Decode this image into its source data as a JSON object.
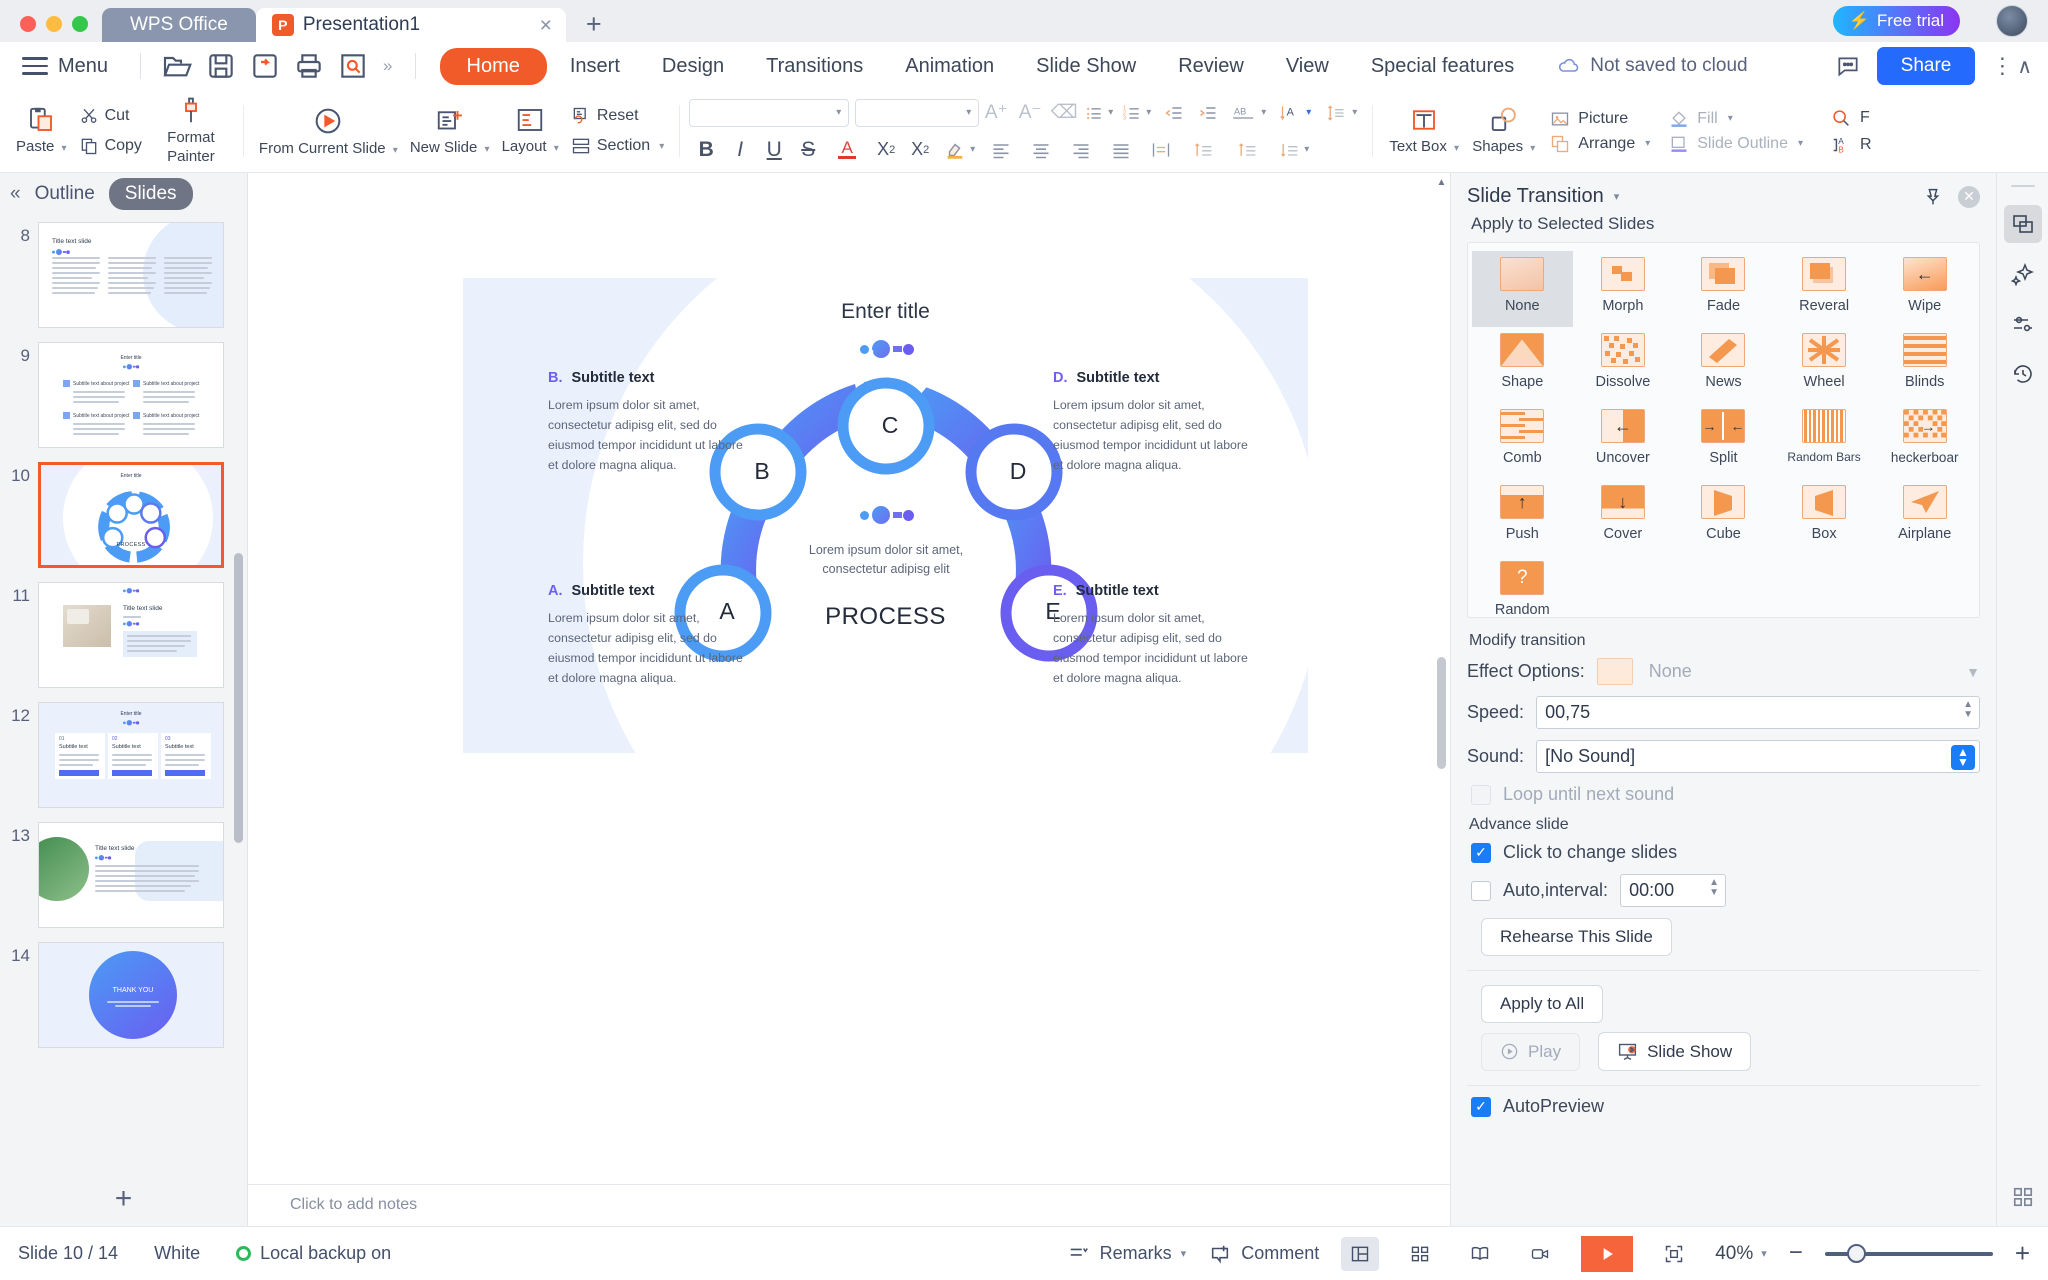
{
  "titlebar": {
    "wps_tab": "WPS Office",
    "doc_tab": "Presentation1",
    "doc_badge": "P",
    "close_glyph": "×",
    "newtab_glyph": "+",
    "free_trial": "Free trial",
    "bolt_glyph": "⚡"
  },
  "menubar": {
    "menu_label": "Menu",
    "quick_icons": [
      "open-folder-icon",
      "save-icon",
      "save-as-icon",
      "print-icon",
      "print-preview-icon"
    ],
    "overflow_glyph": "»",
    "tabs": [
      {
        "label": "Home",
        "active": true
      },
      {
        "label": "Insert",
        "active": false
      },
      {
        "label": "Design",
        "active": false
      },
      {
        "label": "Transitions",
        "active": false
      },
      {
        "label": "Animation",
        "active": false
      },
      {
        "label": "Slide Show",
        "active": false
      },
      {
        "label": "Review",
        "active": false
      },
      {
        "label": "View",
        "active": false
      },
      {
        "label": "Special features",
        "active": false
      }
    ],
    "cloud_status": "Not saved to cloud",
    "share_label": "Share",
    "kebab_glyph": "⋮",
    "collapse_glyph": "∧"
  },
  "ribbon": {
    "paste": "Paste",
    "cut": "Cut",
    "copy": "Copy",
    "format_painter": "Format Painter",
    "from_current_slide": "From Current Slide",
    "new_slide": "New Slide",
    "layout": "Layout",
    "reset": "Reset",
    "section": "Section",
    "font_name": "",
    "font_size": "",
    "font_name_placeholder": "",
    "font_size_placeholder": "",
    "text_box": "Text Box",
    "shapes": "Shapes",
    "picture": "Picture",
    "arrange": "Arrange",
    "fill": "Fill",
    "slide_outline": "Slide Outline",
    "find": "F",
    "replace": "R",
    "caret_glyph": "▾",
    "icons": {
      "bold": "B",
      "italic": "I",
      "underline": "U",
      "strike": "S",
      "font_color": "A",
      "superscript": "X²",
      "subscript": "X₂",
      "highlight": "A",
      "grow_font": "A⁺",
      "shrink_font": "A⁻",
      "clear_format": "⌫"
    }
  },
  "leftpanel": {
    "collapse_glyph": "«",
    "outline_tab": "Outline",
    "slides_tab": "Slides",
    "add_slide_glyph": "+",
    "slides": [
      {
        "number": "8",
        "title": "Title text slide",
        "kind": "three-col-text",
        "active": false
      },
      {
        "number": "9",
        "title": "Enter title",
        "kind": "four-quad",
        "active": false
      },
      {
        "number": "10",
        "title": "Enter title",
        "kind": "process-wheel",
        "active": true
      },
      {
        "number": "11",
        "title": "Title text slide",
        "kind": "photo-left",
        "active": false
      },
      {
        "number": "12",
        "title": "Enter title",
        "kind": "three-cards",
        "active": false
      },
      {
        "number": "13",
        "title": "Title text slide",
        "kind": "leaf-left",
        "active": false
      },
      {
        "number": "14",
        "title": "THANK YOU",
        "kind": "thankyou",
        "active": false
      }
    ]
  },
  "slide": {
    "title": "Enter title",
    "center_text": "Lorem ipsum dolor sit amet, consectetur adipisg elit",
    "process_label": "PROCESS",
    "rings": [
      "A",
      "B",
      "C",
      "D",
      "E"
    ],
    "body_text": "Lorem ipsum dolor sit amet, consectetur adipisg elit, sed do eiusmod tempor incididunt ut labore et dolore magna aliqua.",
    "blocks": [
      {
        "letter": "B.",
        "subtitle": "Subtitle text",
        "pos": "top-left"
      },
      {
        "letter": "D.",
        "subtitle": "Subtitle text",
        "pos": "top-right"
      },
      {
        "letter": "A.",
        "subtitle": "Subtitle text",
        "pos": "bottom-left"
      },
      {
        "letter": "E.",
        "subtitle": "Subtitle text",
        "pos": "bottom-right"
      }
    ]
  },
  "notes": {
    "placeholder": "Click to add notes"
  },
  "rightpanel": {
    "title": "Slide Transition",
    "caret_glyph": "▾",
    "pin_icon": "pin-icon",
    "close_glyph": "✕",
    "subtitle": "Apply to Selected Slides",
    "effects": [
      {
        "name": "None",
        "selected": true,
        "glyph": ""
      },
      {
        "name": "Morph",
        "selected": false,
        "glyph": "morph"
      },
      {
        "name": "Fade",
        "selected": false,
        "glyph": "fade"
      },
      {
        "name": "Reveral",
        "selected": false,
        "glyph": "reveal"
      },
      {
        "name": "Wipe",
        "selected": false,
        "glyph": "←"
      },
      {
        "name": "Shape",
        "selected": false,
        "glyph": "shape"
      },
      {
        "name": "Dissolve",
        "selected": false,
        "glyph": "dissolve"
      },
      {
        "name": "News",
        "selected": false,
        "glyph": "news"
      },
      {
        "name": "Wheel",
        "selected": false,
        "glyph": "wheel"
      },
      {
        "name": "Blinds",
        "selected": false,
        "glyph": "blinds"
      },
      {
        "name": "Comb",
        "selected": false,
        "glyph": "comb"
      },
      {
        "name": "Uncover",
        "selected": false,
        "glyph": "←"
      },
      {
        "name": "Split",
        "selected": false,
        "glyph": "split"
      },
      {
        "name": "Random Bars",
        "selected": false,
        "glyph": "bars",
        "small": true
      },
      {
        "name": "heckerboar",
        "selected": false,
        "glyph": "→"
      },
      {
        "name": "Push",
        "selected": false,
        "glyph": "↑"
      },
      {
        "name": "Cover",
        "selected": false,
        "glyph": "↓"
      },
      {
        "name": "Cube",
        "selected": false,
        "glyph": "cube"
      },
      {
        "name": "Box",
        "selected": false,
        "glyph": "box"
      },
      {
        "name": "Airplane",
        "selected": false,
        "glyph": "plane"
      },
      {
        "name": "Random",
        "selected": false,
        "glyph": "?"
      }
    ],
    "modify_heading": "Modify transition",
    "effect_options_label": "Effect Options:",
    "effect_options_value": "None",
    "speed_label": "Speed:",
    "speed_value": "00,75",
    "sound_label": "Sound:",
    "sound_value": "[No Sound]",
    "loop_label": "Loop until next sound",
    "loop_checked": false,
    "advance_heading": "Advance slide",
    "click_change_label": "Click to change slides",
    "click_change_checked": true,
    "auto_interval_label": "Auto,interval:",
    "auto_interval_value": "00:00",
    "auto_interval_checked": false,
    "rehearse_label": "Rehearse This Slide",
    "apply_all_label": "Apply to All",
    "play_label": "Play",
    "slide_show_label": "Slide Show",
    "autopreview_label": "AutoPreview",
    "autopreview_checked": true,
    "check_glyph": "✓"
  },
  "iconstrip": [
    "transition-icon",
    "animation-star-icon",
    "settings-sliders-icon",
    "history-clock-icon",
    "grid-icon"
  ],
  "status": {
    "slide_counter": "Slide 10 / 14",
    "theme": "White",
    "backup": "Local backup on",
    "remarks": "Remarks",
    "comment": "Comment",
    "zoom": "40%",
    "zoom_out_glyph": "−",
    "zoom_in_glyph": "+",
    "caret_glyph": "▾"
  },
  "colors": {
    "accent_orange": "#f15a29",
    "accent_blue": "#246bfd",
    "slide_blue": "#4c9bf5",
    "slide_purple": "#6a5ef0",
    "panel_bg": "#f5f6f8"
  }
}
